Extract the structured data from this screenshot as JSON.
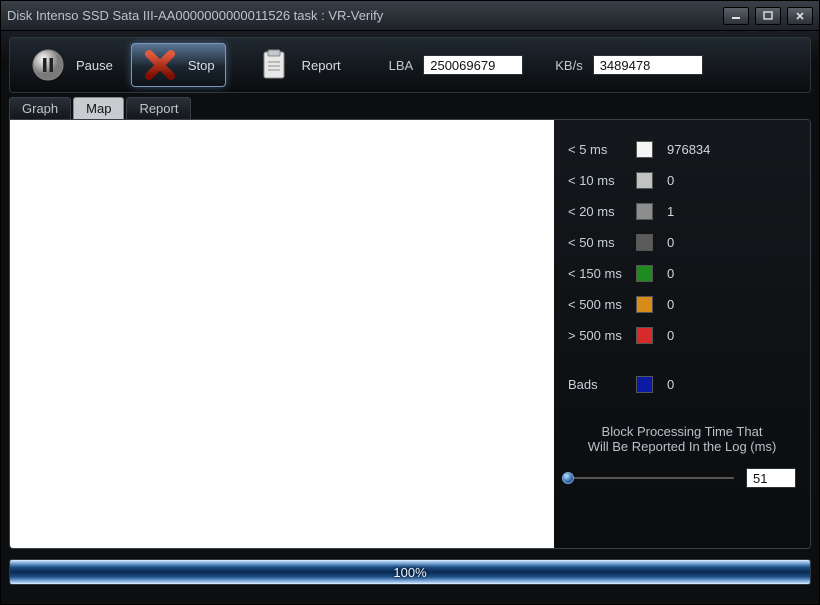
{
  "title": "Disk Intenso SSD Sata III-AA0000000000011526   task : VR-Verify",
  "toolbar": {
    "pause_label": "Pause",
    "stop_label": "Stop",
    "report_label": "Report",
    "lba_label": "LBA",
    "lba_value": "250069679",
    "kbs_label": "KB/s",
    "kbs_value": "3489478"
  },
  "tabs": {
    "graph": "Graph",
    "map": "Map",
    "report": "Report",
    "active": "map"
  },
  "legend": [
    {
      "label": "< 5 ms",
      "color": "#f5f5f5",
      "count": "976834"
    },
    {
      "label": "< 10 ms",
      "color": "#c2c2c2",
      "count": "0"
    },
    {
      "label": "< 20 ms",
      "color": "#8d8d8d",
      "count": "1"
    },
    {
      "label": "< 50 ms",
      "color": "#5b5b5b",
      "count": "0"
    },
    {
      "label": "< 150 ms",
      "color": "#1d8b1d",
      "count": "0"
    },
    {
      "label": "< 500 ms",
      "color": "#d98b1a",
      "count": "0"
    },
    {
      "label": "> 500 ms",
      "color": "#d72a2a",
      "count": "0"
    }
  ],
  "bads": {
    "label": "Bads",
    "color": "#0c1aa3",
    "count": "0"
  },
  "log_note_line1": "Block Processing Time That",
  "log_note_line2": "Will Be Reported In the Log (ms)",
  "slider_value": "51",
  "progress": {
    "percent": "100%",
    "width": "100%"
  }
}
